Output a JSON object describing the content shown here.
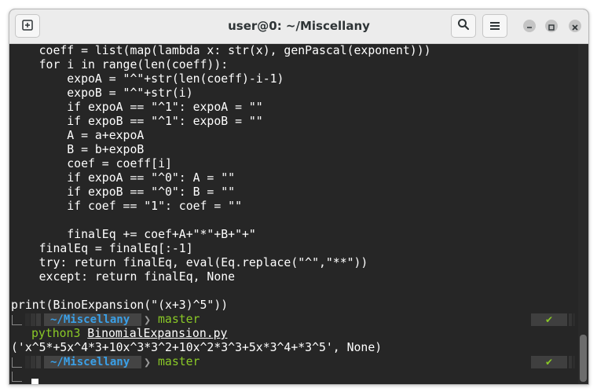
{
  "window": {
    "title": "user@0: ~/Miscellany"
  },
  "header": {
    "new_tab_icon": "new-tab-icon",
    "search_icon": "search-icon",
    "menu_icon": "hamburger-menu-icon",
    "minimize_icon": "minimize-icon",
    "maximize_icon": "maximize-icon",
    "close_icon": "close-icon"
  },
  "terminal": {
    "code_lines": [
      "    coeff = list(map(lambda x: str(x), genPascal(exponent)))",
      "    for i in range(len(coeff)):",
      "        expoA = \"^\"+str(len(coeff)-i-1)",
      "        expoB = \"^\"+str(i)",
      "        if expoA == \"^1\": expoA = \"\"",
      "        if expoB == \"^1\": expoB = \"\"",
      "        A = a+expoA",
      "        B = b+expoB",
      "        coef = coeff[i]",
      "        if expoA == \"^0\": A = \"\"",
      "        if expoB == \"^0\": B = \"\"",
      "        if coef == \"1\": coef = \"\"",
      "",
      "        finalEq += coef+A+\"*\"+B+\"+\"",
      "    finalEq = finalEq[:-1]",
      "    try: return finalEq, eval(Eq.replace(\"^\",\"**\"))",
      "    except: return finalEq, None",
      "",
      "print(BinoExpansion(\"(x+3)^5\"))"
    ],
    "prompt1": {
      "path": "~/Miscellany",
      "separator": "❯",
      "branch": "master",
      "status": "✔"
    },
    "command": {
      "name": "python3",
      "arg": "BinomialExpansion.py"
    },
    "output": "('x^5*+5x^4*3+10x^3*3^2+10x^2*3^3+5x*3^4+*3^5', None)",
    "prompt2": {
      "path": "~/Miscellany",
      "separator": "❯",
      "branch": "master",
      "status": "✔"
    }
  },
  "colors": {
    "terminal_bg": "#262626",
    "path_fg": "#3aa0e8",
    "branch_fg": "#8ac926",
    "segment_bg": "#444444"
  }
}
